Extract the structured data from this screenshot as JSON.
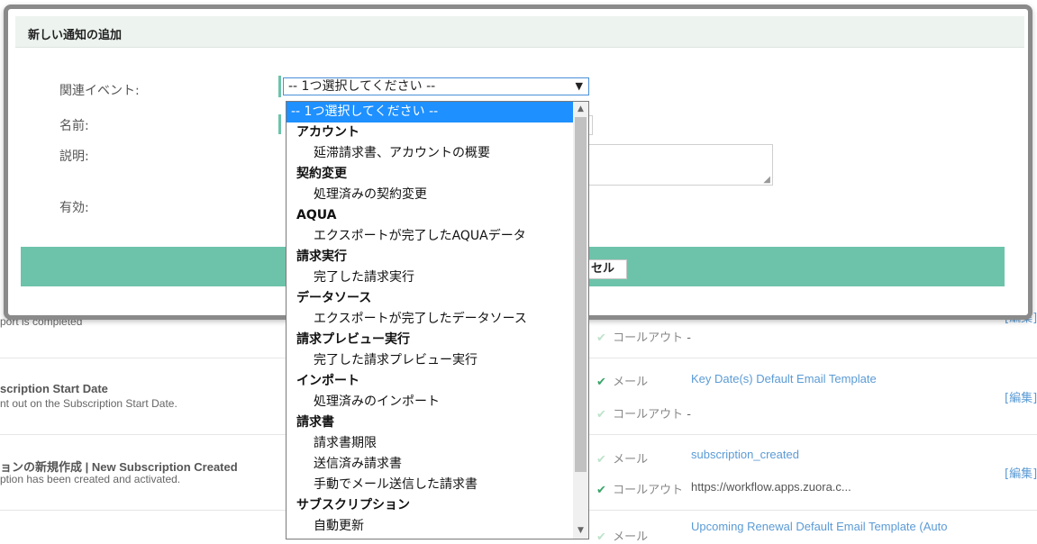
{
  "modal": {
    "title": "新しい通知の追加",
    "fields": {
      "related_event_label": "関連イベント:",
      "name_label": "名前:",
      "description_label": "説明:",
      "active_label": "有効:"
    },
    "select_value": "-- 1つ選択してください --",
    "cancel_label": "セル"
  },
  "dropdown": {
    "options": [
      {
        "type": "selected",
        "label": "-- 1つ選択してください --"
      },
      {
        "type": "group",
        "label": "アカウント"
      },
      {
        "type": "item",
        "label": "延滞請求書、アカウントの概要"
      },
      {
        "type": "group",
        "label": "契約変更"
      },
      {
        "type": "item",
        "label": "処理済みの契約変更"
      },
      {
        "type": "group",
        "label": "AQUA"
      },
      {
        "type": "item",
        "label": "エクスポートが完了したAQUAデータ"
      },
      {
        "type": "group",
        "label": "請求実行"
      },
      {
        "type": "item",
        "label": "完了した請求実行"
      },
      {
        "type": "group",
        "label": "データソース"
      },
      {
        "type": "item",
        "label": "エクスポートが完了したデータソース"
      },
      {
        "type": "group",
        "label": "請求プレビュー実行"
      },
      {
        "type": "item",
        "label": "完了した請求プレビュー実行"
      },
      {
        "type": "group",
        "label": "インポート"
      },
      {
        "type": "item",
        "label": "処理済みのインポート"
      },
      {
        "type": "group",
        "label": "請求書"
      },
      {
        "type": "item",
        "label": "請求書期限"
      },
      {
        "type": "item",
        "label": "送信済み請求書"
      },
      {
        "type": "item",
        "label": "手動でメール送信した請求書"
      },
      {
        "type": "group",
        "label": "サブスクリプション"
      },
      {
        "type": "item",
        "label": "自動更新"
      }
    ]
  },
  "background": {
    "row1": {
      "desc": "port is completed",
      "callout_label": "コールアウト",
      "callout_value": "-",
      "edit_label": "[編集]"
    },
    "row2": {
      "title": "scription Start Date",
      "desc": "nt out on the Subscription Start Date.",
      "email_label": "メール",
      "template": "Key Date(s) Default Email Template",
      "callout_label": "コールアウト",
      "callout_value": "-",
      "edit_label": "[編集]"
    },
    "row3": {
      "title": "ョンの新規作成 | New Subscription Created",
      "desc": "ption has been created and activated.",
      "email_label": "メール",
      "template": "subscription_created",
      "callout_label": "コールアウト",
      "url": "https://workflow.apps.zuora.c...",
      "edit_label": "[編集]"
    },
    "row4": {
      "email_label": "メール",
      "template": "Upcoming Renewal Default Email Template (Auto"
    }
  }
}
